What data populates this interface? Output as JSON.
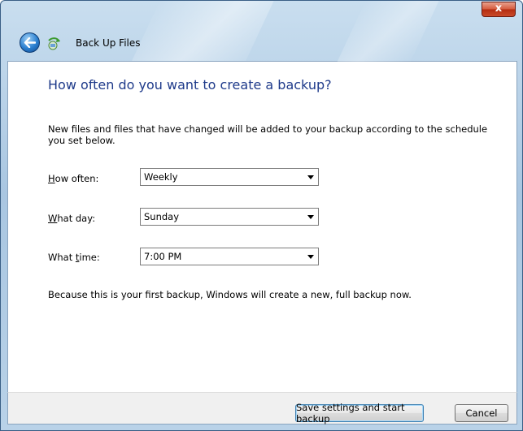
{
  "window": {
    "title": "Back Up Files",
    "close_label": "x"
  },
  "page": {
    "heading": "How often do you want to create a backup?",
    "description": "New files and files that have changed will be added to your backup according to the schedule you set below.",
    "note": "Because this is your first backup, Windows will create a new, full backup now."
  },
  "fields": {
    "how_often": {
      "label_prefix": "",
      "label_accel": "H",
      "label_rest": "ow often:",
      "value": "Weekly"
    },
    "what_day": {
      "label_prefix": "",
      "label_accel": "W",
      "label_rest": "hat day:",
      "value": "Sunday"
    },
    "what_time": {
      "label_prefix": "What ",
      "label_accel": "t",
      "label_rest": "ime:",
      "value": "7:00 PM"
    }
  },
  "footer": {
    "primary_label": "Save settings and start backup",
    "cancel_label": "Cancel"
  },
  "icons": {
    "back": "back-arrow-icon",
    "app": "backup-icon",
    "dropdown": "chevron-down-icon"
  },
  "colors": {
    "heading": "#1e3a8a",
    "frame": "#a9c6e1",
    "close": "#c94a2a"
  }
}
